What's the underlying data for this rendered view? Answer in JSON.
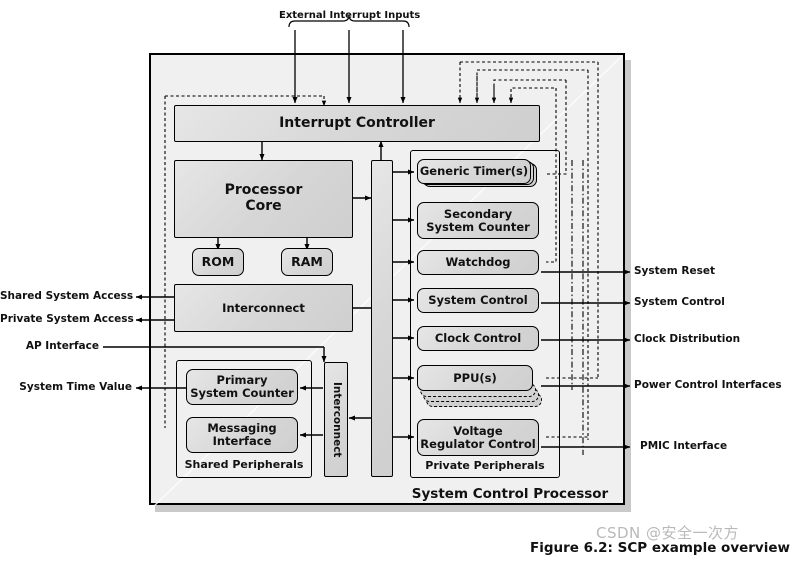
{
  "figure": {
    "caption": "Figure 6.2: SCP example overview",
    "watermark": "CSDN @安全一次方"
  },
  "top": {
    "external_inputs_label": "External Interrupt Inputs",
    "arrow_count": 3
  },
  "outer_block": {
    "title": "System Control Processor"
  },
  "blocks": {
    "interrupt_controller": "Interrupt Controller",
    "processor_core_line1": "Processor",
    "processor_core_line2": "Core",
    "rom": "ROM",
    "ram": "RAM",
    "interconnect_main": "Interconnect",
    "interconnect_vertical": "Interconnect",
    "interconnect_bus": ""
  },
  "shared_peripherals": {
    "title": "Shared Peripherals",
    "items": [
      {
        "line1": "Primary",
        "line2": "System Counter"
      },
      {
        "line1": "Messaging",
        "line2": "Interface"
      }
    ]
  },
  "private_peripherals": {
    "title": "Private Peripherals",
    "items": [
      {
        "line1": "Generic Timer(s)",
        "line2": "",
        "stacked": true
      },
      {
        "line1": "Secondary",
        "line2": "System Counter",
        "stacked": false
      },
      {
        "line1": "Watchdog",
        "line2": "",
        "stacked": false
      },
      {
        "line1": "System Control",
        "line2": "",
        "stacked": false
      },
      {
        "line1": "Clock Control",
        "line2": "",
        "stacked": false
      },
      {
        "line1": "PPU(s)",
        "line2": "",
        "stacked": true
      },
      {
        "line1": "Voltage",
        "line2": "Regulator Control",
        "stacked": false
      }
    ]
  },
  "left_labels": [
    {
      "text": "Shared System Access"
    },
    {
      "text": "Private System Access"
    },
    {
      "text": "AP Interface"
    },
    {
      "text": "System Time Value"
    }
  ],
  "right_labels": [
    {
      "text": "System Reset"
    },
    {
      "text": "System Control"
    },
    {
      "text": "Clock Distribution"
    },
    {
      "text": "Power Control Interfaces"
    },
    {
      "text": "PMIC Interface"
    }
  ],
  "colors": {
    "block_fill": "#d8d8d8",
    "outer_fill": "#f0f0f0",
    "stroke": "#000000",
    "shadow": "#c9c9c9",
    "watermark": "#b9b9b9"
  }
}
